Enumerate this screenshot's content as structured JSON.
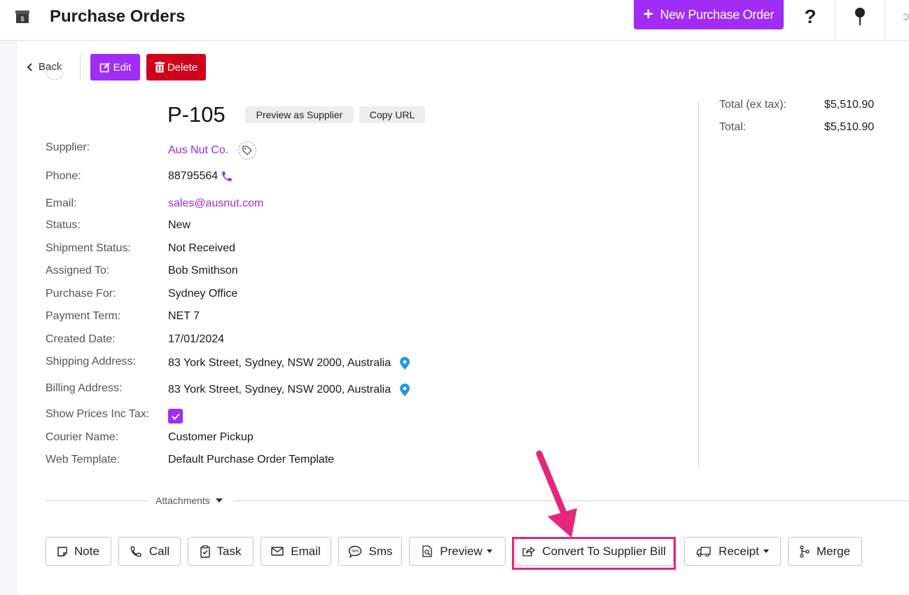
{
  "topbar": {
    "title": "Purchase Orders",
    "new_button": "New Purchase Order",
    "plus": "+",
    "help_glyph": "?"
  },
  "actions": {
    "back": "Back",
    "edit": "Edit",
    "delete": "Delete"
  },
  "header": {
    "po_number": "P-105",
    "preview_supplier": "Preview as Supplier",
    "copy_url": "Copy URL"
  },
  "details": {
    "supplier": {
      "label": "Supplier:",
      "value": "Aus Nut Co."
    },
    "phone": {
      "label": "Phone:",
      "value": "88795564"
    },
    "email": {
      "label": "Email:",
      "value": "sales@ausnut.com"
    },
    "status": {
      "label": "Status:",
      "value": "New"
    },
    "shipment_status": {
      "label": "Shipment Status:",
      "value": "Not Received"
    },
    "assigned_to": {
      "label": "Assigned To:",
      "value": "Bob Smithson"
    },
    "purchase_for": {
      "label": "Purchase For:",
      "value": "Sydney Office"
    },
    "payment_term": {
      "label": "Payment Term:",
      "value": "NET 7"
    },
    "created_date": {
      "label": "Created Date:",
      "value": "17/01/2024"
    },
    "shipping_address": {
      "label": "Shipping Address:",
      "value": "83 York Street, Sydney, NSW 2000, Australia"
    },
    "billing_address": {
      "label": "Billing Address:",
      "value": "83 York Street, Sydney, NSW 2000, Australia"
    },
    "show_prices_inc_tax": {
      "label": "Show Prices Inc Tax:",
      "checked": true
    },
    "courier_name": {
      "label": "Courier Name:",
      "value": "Customer Pickup"
    },
    "web_template": {
      "label": "Web Template:",
      "value": "Default Purchase Order Template"
    }
  },
  "totals": {
    "ex_tax_label": "Total (ex tax):",
    "ex_tax_value": "$5,510.90",
    "total_label": "Total:",
    "total_value": "$5,510.90"
  },
  "attachments": {
    "label": "Attachments"
  },
  "bottom_actions": {
    "note": "Note",
    "call": "Call",
    "task": "Task",
    "email": "Email",
    "sms": "Sms",
    "preview": "Preview",
    "convert": "Convert To Supplier Bill",
    "receipt": "Receipt",
    "merge": "Merge"
  },
  "colors": {
    "accent": "#a02cf5",
    "danger": "#d0021b",
    "link": "#9b2de0",
    "highlight": "#e6267a",
    "map_pin": "#1e9be0"
  },
  "icons": {
    "app": "store-icon",
    "help": "question-icon",
    "pin": "pin-icon",
    "undo": "undo-icon",
    "back": "chevron-left-icon",
    "edit": "edit-icon",
    "delete": "trash-icon",
    "tag": "tag-icon",
    "phone": "phone-icon",
    "map": "map-pin-icon",
    "check": "check-icon",
    "note": "note-icon",
    "call": "phone-icon",
    "task": "clipboard-icon",
    "email": "envelope-icon",
    "sms": "sms-icon",
    "preview": "document-search-icon",
    "convert": "share-icon",
    "receipt": "truck-icon",
    "merge": "merge-icon",
    "annotation": "arrow-icon"
  }
}
